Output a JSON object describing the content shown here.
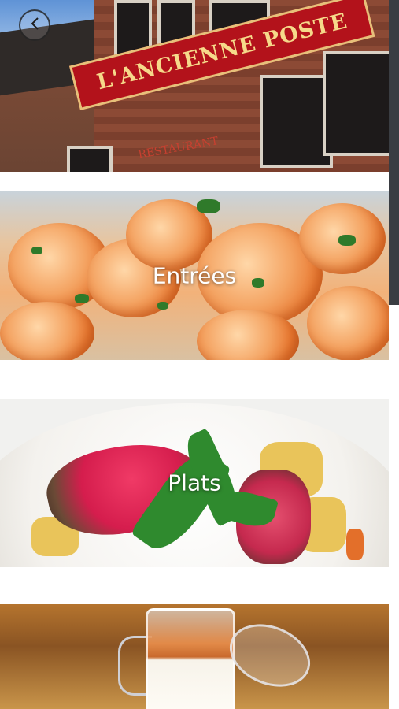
{
  "hero": {
    "sign_text": "L'ANCIENNE POSTE",
    "subsign_text": "RESTAURANT",
    "back_icon": "arrow-left-icon"
  },
  "categories": [
    {
      "label": "Entrées"
    },
    {
      "label": "Plats"
    },
    {
      "label": ""
    }
  ]
}
